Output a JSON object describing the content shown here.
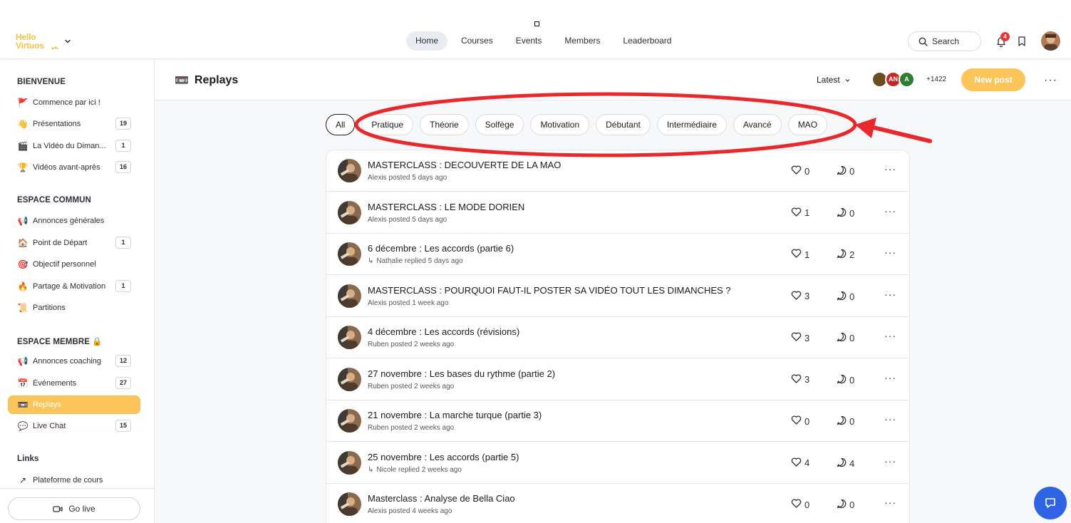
{
  "app": {
    "logo_line1": "Hello",
    "logo_line2": "Virtuos",
    "brand_color": "#fcc55a"
  },
  "topnav": {
    "items": [
      "Home",
      "Courses",
      "Events",
      "Members",
      "Leaderboard"
    ],
    "active": "Home",
    "search_label": "Search",
    "notifications_count": "4"
  },
  "sidebar": {
    "sections": [
      {
        "title": "BIENVENUE",
        "items": [
          {
            "emoji": "🚩",
            "label": "Commence par ici !",
            "count": ""
          },
          {
            "emoji": "👋",
            "label": "Présentations",
            "count": "19"
          },
          {
            "emoji": "🎬",
            "label": "La Vidéo du Diman...",
            "count": "1"
          },
          {
            "emoji": "🏆",
            "label": "Vidéos avant-après",
            "count": "16"
          }
        ]
      },
      {
        "title": "ESPACE COMMUN",
        "items": [
          {
            "emoji": "📢",
            "label": "Annonces générales",
            "count": ""
          },
          {
            "emoji": "🏠",
            "label": "Point de Départ",
            "count": "1"
          },
          {
            "emoji": "🎯",
            "label": "Objectif personnel",
            "count": ""
          },
          {
            "emoji": "🔥",
            "label": "Partage & Motivation",
            "count": "1"
          },
          {
            "emoji": "📜",
            "label": "Partitions",
            "count": ""
          }
        ]
      },
      {
        "title": "ESPACE MEMBRE 🔒",
        "items": [
          {
            "emoji": "📢",
            "label": "Annonces coaching",
            "count": "12"
          },
          {
            "emoji": "📅",
            "label": "Événements",
            "count": "27"
          },
          {
            "emoji": "📼",
            "label": "Replays",
            "count": "",
            "active": true
          },
          {
            "emoji": "💬",
            "label": "Live Chat",
            "count": "15"
          }
        ]
      },
      {
        "title": "Links",
        "items": [
          {
            "emoji": "↗",
            "label": "Plateforme de cours",
            "count": ""
          }
        ]
      }
    ],
    "go_live_label": "Go live"
  },
  "space": {
    "emoji": "📼",
    "title": "Replays",
    "sort_label": "Latest",
    "members": [
      {
        "initials": "",
        "color": "#6b4e1f"
      },
      {
        "initials": "AN",
        "color": "#c62828"
      },
      {
        "initials": "A",
        "color": "#2e7d32"
      }
    ],
    "member_extra": "+1422",
    "new_post_label": "New post"
  },
  "filters": {
    "chips": [
      "All",
      "Pratique",
      "Théorie",
      "Solfège",
      "Motivation",
      "Débutant",
      "Intermédiaire",
      "Avancé",
      "MAO"
    ],
    "active": "All",
    "annotation_color": "#e8282b"
  },
  "posts": [
    {
      "title": "MASTERCLASS : DECOUVERTE DE LA MAO",
      "meta": "Alexis posted 5 days ago",
      "reply": false,
      "likes": "0",
      "comments": "0"
    },
    {
      "title": "MASTERCLASS : LE MODE DORIEN",
      "meta": "Alexis posted 5 days ago",
      "reply": false,
      "likes": "1",
      "comments": "0"
    },
    {
      "title": "6 décembre : Les accords (partie 6)",
      "meta": "Nathalie replied 5 days ago",
      "reply": true,
      "likes": "1",
      "comments": "2"
    },
    {
      "title": "MASTERCLASS : POURQUOI FAUT-IL POSTER SA VIDÉO TOUT LES DIMANCHES ?",
      "meta": "Alexis posted 1 week ago",
      "reply": false,
      "likes": "3",
      "comments": "0"
    },
    {
      "title": "4 décembre : Les accords (révisions)",
      "meta": "Ruben posted 2 weeks ago",
      "reply": false,
      "likes": "3",
      "comments": "0"
    },
    {
      "title": "27 novembre : Les bases du rythme (partie 2)",
      "meta": "Ruben posted 2 weeks ago",
      "reply": false,
      "likes": "3",
      "comments": "0"
    },
    {
      "title": "21 novembre : La marche turque (partie 3)",
      "meta": "Ruben posted 2 weeks ago",
      "reply": false,
      "likes": "0",
      "comments": "0"
    },
    {
      "title": "25 novembre : Les accords (partie 5)",
      "meta": "Nicole replied 2 weeks ago",
      "reply": true,
      "likes": "4",
      "comments": "4"
    },
    {
      "title": "Masterclass : Analyse de Bella Ciao",
      "meta": "Alexis posted 4 weeks ago",
      "reply": false,
      "likes": "0",
      "comments": "0"
    }
  ]
}
